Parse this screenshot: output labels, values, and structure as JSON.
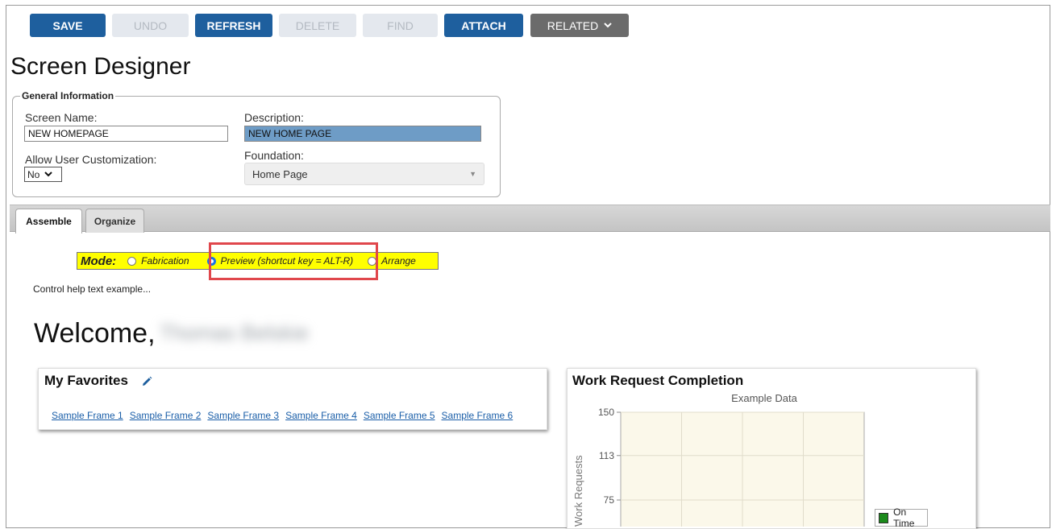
{
  "toolbar": {
    "save": "SAVE",
    "undo": "UNDO",
    "refresh": "REFRESH",
    "delete": "DELETE",
    "find": "FIND",
    "attach": "ATTACH",
    "related": "RELATED"
  },
  "page": {
    "title": "Screen Designer"
  },
  "general": {
    "legend": "General Information",
    "screen_name_label": "Screen Name:",
    "screen_name_value": "NEW HOMEPAGE",
    "description_label": "Description:",
    "description_value": "NEW HOME PAGE",
    "allow_label": "Allow User Customization:",
    "allow_value": "No",
    "foundation_label": "Foundation:",
    "foundation_value": "Home Page"
  },
  "tabs": [
    {
      "label": "Assemble"
    },
    {
      "label": "Organize"
    }
  ],
  "mode": {
    "label": "Mode:",
    "options": [
      {
        "label": "Fabrication",
        "checked": false
      },
      {
        "label": "Preview (shortcut key = ALT-R)",
        "checked": true
      },
      {
        "label": "Arrange",
        "checked": false
      }
    ]
  },
  "help_text": "Control help text example...",
  "welcome": {
    "greeting": "Welcome,",
    "name": "Thomas Belskie"
  },
  "favorites": {
    "title": "My Favorites",
    "links": [
      "Sample Frame 1",
      "Sample Frame 2",
      "Sample Frame 3",
      "Sample Frame 4",
      "Sample Frame 5",
      "Sample Frame 6"
    ]
  },
  "chart_panel": {
    "title": "Work Request Completion"
  },
  "chart_data": {
    "type": "bar",
    "title": "Example Data",
    "xlabel": "",
    "ylabel": "Work Requests",
    "ylim": [
      0,
      150
    ],
    "yticks": [
      "150",
      "113",
      "75"
    ],
    "series": [
      {
        "name": "On Time",
        "values": []
      }
    ],
    "grid": true,
    "legend_position": "right",
    "colors": {
      "plot_bg": "#fbf8ea",
      "on_time": "#1b8a1b"
    }
  }
}
